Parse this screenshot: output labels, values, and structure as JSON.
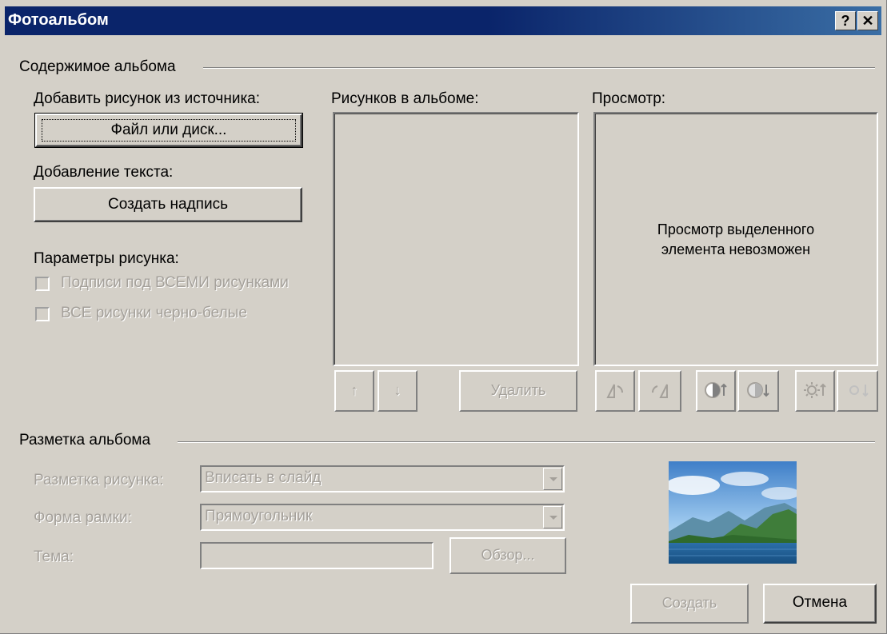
{
  "window": {
    "title": "Фотоальбом",
    "help_glyph": "?",
    "close_glyph": "✕"
  },
  "content_group": {
    "title": "Содержимое альбома",
    "add_picture_label": "Добавить рисунок из источника:",
    "file_button": "Файл или диск...",
    "add_text_label": "Добавление текста:",
    "create_caption_button": "Создать надпись",
    "picture_options_label": "Параметры рисунка:",
    "captions_checkbox": "Подписи под ВСЕМИ рисунками",
    "bw_checkbox": "ВСЕ рисунки черно-белые",
    "pictures_in_album_label": "Рисунков в альбоме:",
    "preview_label": "Просмотр:",
    "preview_message_line1": "Просмотр выделенного",
    "preview_message_line2": "элемента невозможен",
    "move_up_glyph": "↑",
    "move_down_glyph": "↓",
    "delete_button": "Удалить"
  },
  "layout_group": {
    "title": "Разметка альбома",
    "picture_layout_label": "Разметка рисунка:",
    "picture_layout_value": "Вписать в слайд",
    "frame_shape_label": "Форма рамки:",
    "frame_shape_value": "Прямоугольник",
    "theme_label": "Тема:",
    "theme_value": "",
    "browse_button": "Обзор..."
  },
  "footer": {
    "create_button": "Создать",
    "cancel_button": "Отмена"
  },
  "colors": {
    "face": "#d4d0c8",
    "titlebar": "#0a246a",
    "disabled_text": "#a4a09a"
  },
  "icons": [
    "rotate-left-icon",
    "rotate-right-icon",
    "contrast-up-icon",
    "contrast-down-icon",
    "brightness-up-icon",
    "brightness-down-icon",
    "landscape-thumbnail"
  ]
}
